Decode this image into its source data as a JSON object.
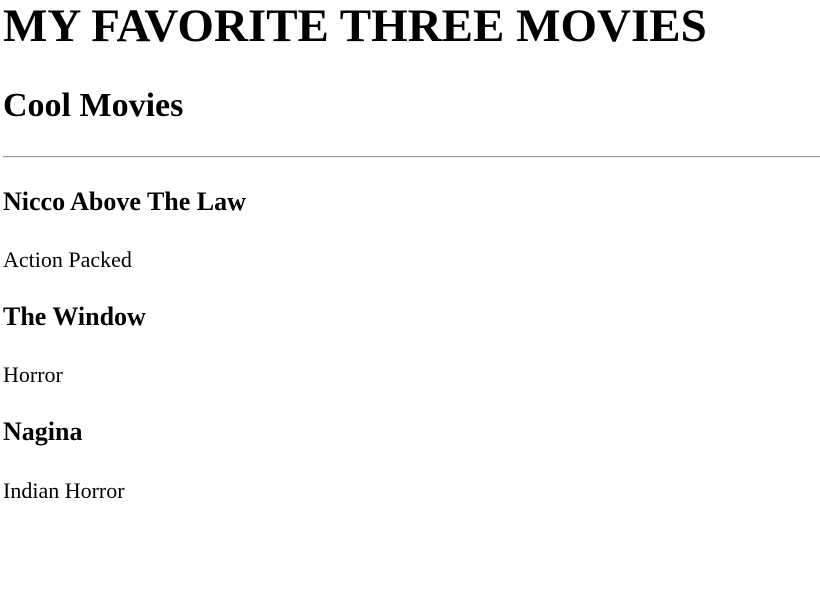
{
  "page": {
    "title": "MY FAVORITE THREE MOVIES",
    "subtitle": "Cool Movies"
  },
  "movies": [
    {
      "title": "Nicco Above The Law",
      "genre": "Action Packed"
    },
    {
      "title": "The Window",
      "genre": "Horror"
    },
    {
      "title": "Nagina",
      "genre": "Indian Horror"
    }
  ]
}
